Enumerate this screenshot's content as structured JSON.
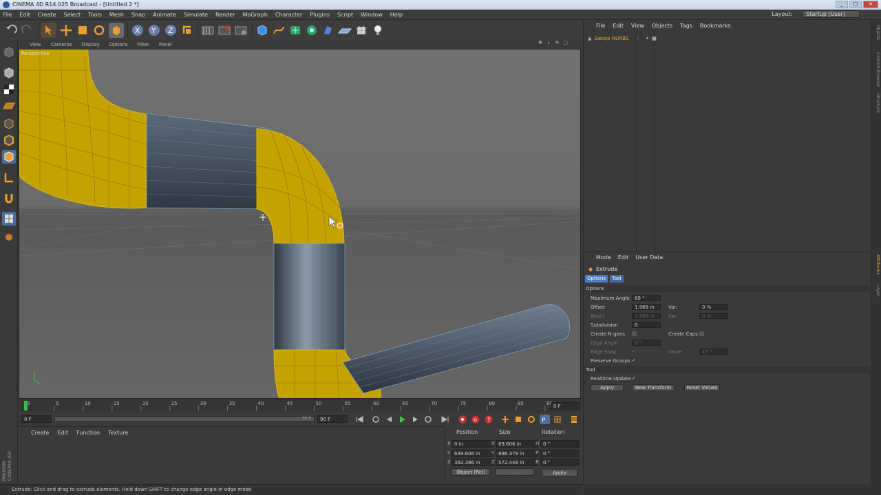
{
  "window": {
    "title": "CINEMA 4D R14.025 Broadcast - [Untitled 2 *]"
  },
  "menu": [
    "File",
    "Edit",
    "Create",
    "Select",
    "Tools",
    "Mesh",
    "Snap",
    "Animate",
    "Simulate",
    "Render",
    "MoGraph",
    "Character",
    "Plugins",
    "Script",
    "Window",
    "Help"
  ],
  "layout": {
    "label": "Layout:",
    "value": "Startup (User)"
  },
  "viewport": {
    "menu": [
      "View",
      "Cameras",
      "Display",
      "Options",
      "Filter",
      "Panel"
    ],
    "camera_label": "Perspective"
  },
  "timeline": {
    "ticks": [
      "0",
      "5",
      "10",
      "15",
      "20",
      "25",
      "30",
      "35",
      "40",
      "45",
      "50",
      "55",
      "60",
      "65",
      "70",
      "75",
      "80",
      "85",
      "90"
    ],
    "current_frame_display": "0 F",
    "start_field": "0 F",
    "end_field": "90 F",
    "range_end": "90 F"
  },
  "material_manager": {
    "menu": [
      "Create",
      "Edit",
      "Function",
      "Texture"
    ]
  },
  "coordinates": {
    "headers": [
      "Position",
      "Size",
      "Rotation"
    ],
    "rows": [
      {
        "pos_axis": "X",
        "pos": "0 in",
        "size_axis": "X",
        "size": "69.606 in",
        "rot_axis": "H",
        "rot": "0 °"
      },
      {
        "pos_axis": "Y",
        "pos": "649.606 in",
        "size_axis": "Y",
        "size": "896.378 in",
        "rot_axis": "P",
        "rot": "0 °"
      },
      {
        "pos_axis": "Z",
        "pos": "392.386 in",
        "size_axis": "Z",
        "size": "572.448 in",
        "rot_axis": "B",
        "rot": "0 °"
      }
    ],
    "mode": "Object (Rel)",
    "size_mode": "Size",
    "apply": "Apply"
  },
  "status_text": "Extrude: Click and drag to extrude elements. Hold down SHIFT to change edge angle in edge mode",
  "maxon_logo": "MAXON CINEMA 4D",
  "object_manager": {
    "menu": [
      "File",
      "Edit",
      "View",
      "Objects",
      "Tags",
      "Bookmarks"
    ],
    "object": "Sweep NURBS"
  },
  "attribute_manager": {
    "menu": [
      "Mode",
      "Edit",
      "User Data"
    ],
    "tool_title": "Extrude",
    "tabs": [
      "Options",
      "Tool"
    ],
    "section_options": "Options",
    "max_angle_label": "Maximum Angle",
    "max_angle_value": "89 °",
    "offset_label": "Offset",
    "offset_value": "1.969 in",
    "var_label": "Var.",
    "var_value": "0 %",
    "bevel_label": "Bevel",
    "bevel_value": "1.969 in",
    "bevel_var_label": "Var.",
    "bevel_var_value": "0 %",
    "subdivision_label": "Subdivision",
    "subdivision_value": "0",
    "create_ngons_label": "Create N-gons",
    "create_caps_label": "Create Caps",
    "edge_angle_label": "Edge Angle",
    "edge_angle_value": "0 °",
    "edge_snap_label": "Edge Snap",
    "value_label": "Value",
    "value_value": "15 °",
    "preserve_groups_label": "Preserve Groups",
    "section_tool": "Tool",
    "realtime_update_label": "Realtime Update",
    "buttons": [
      "Apply",
      "New Transform",
      "Reset Values"
    ]
  },
  "right_tabs": [
    "Objects",
    "Content Browser",
    "Structure",
    "Attributes",
    "Layer"
  ],
  "colors": {
    "accent": "#4a78c2",
    "selection_yellow": "#d2b400",
    "orange": "#e8a033",
    "panel": "#3a3a3a"
  }
}
